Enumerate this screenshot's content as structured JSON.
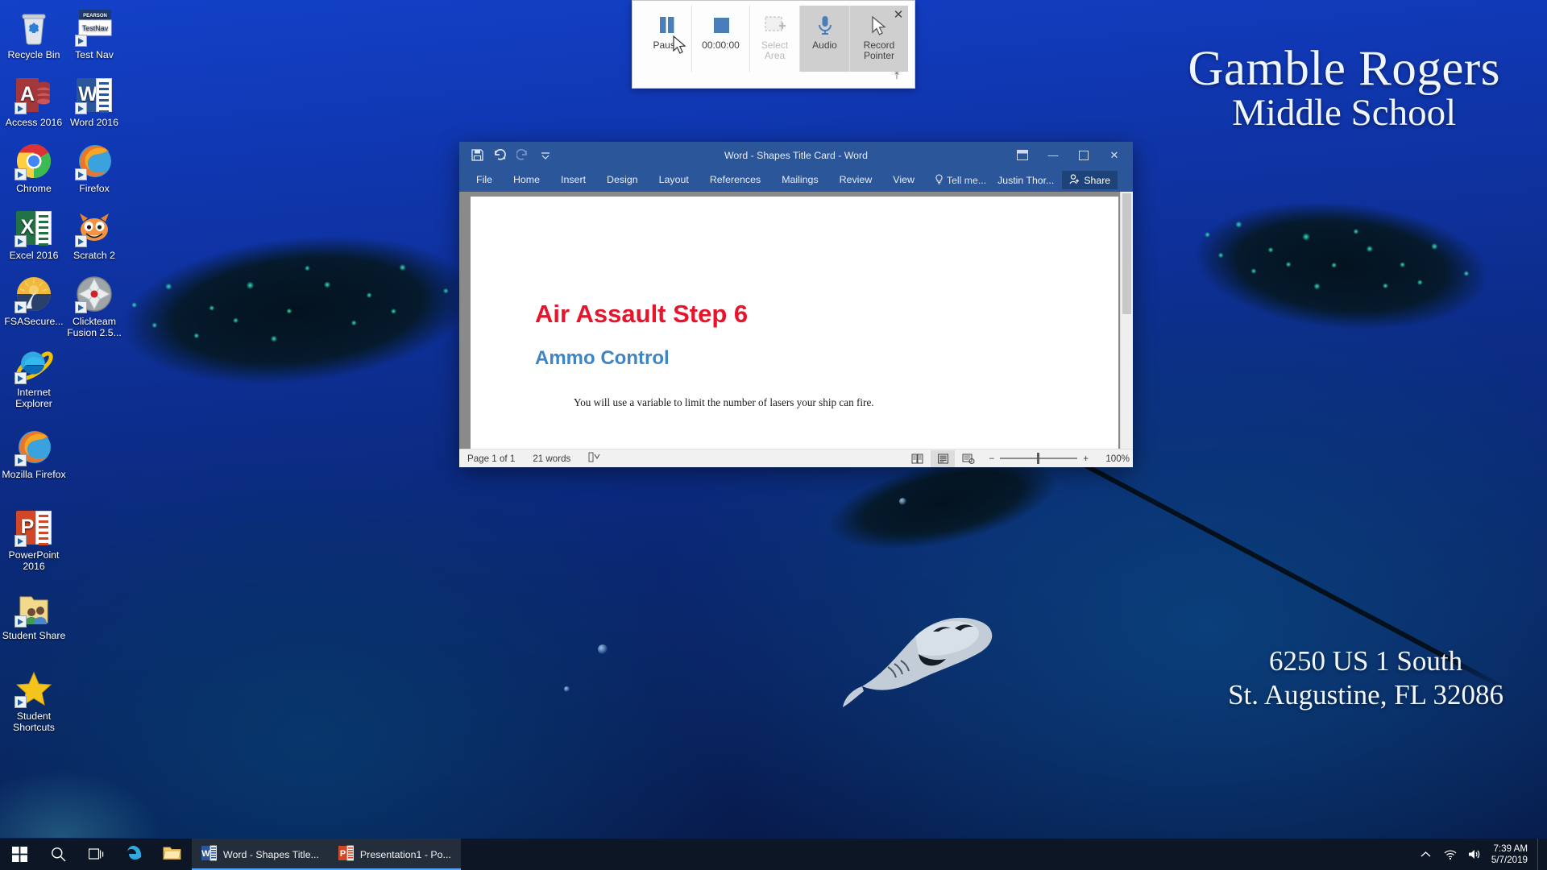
{
  "wallpaper": {
    "school_line1": "Gamble Rogers",
    "school_line2": "Middle School",
    "address_line1": "6250 US 1 South",
    "address_line2": "St. Augustine, FL 32086",
    "background_color": "#0e3099",
    "logo_name": "stingray-mascot"
  },
  "desktop_icons": [
    {
      "label": "Recycle Bin",
      "icon": "recycle-bin-icon",
      "shortcut": false,
      "col": 0,
      "row": 0
    },
    {
      "label": "Test Nav",
      "icon": "pearson-testnav-icon",
      "shortcut": true,
      "col": 1,
      "row": 0
    },
    {
      "label": "Access 2016",
      "icon": "access-2016-icon",
      "shortcut": true,
      "col": 0,
      "row": 1
    },
    {
      "label": "Word 2016",
      "icon": "word-2016-icon",
      "shortcut": true,
      "col": 1,
      "row": 1
    },
    {
      "label": "Chrome",
      "icon": "google-chrome-icon",
      "shortcut": true,
      "col": 0,
      "row": 2
    },
    {
      "label": "Firefox",
      "icon": "firefox-icon",
      "shortcut": true,
      "col": 1,
      "row": 2
    },
    {
      "label": "Excel 2016",
      "icon": "excel-2016-icon",
      "shortcut": true,
      "col": 0,
      "row": 3
    },
    {
      "label": "Scratch 2",
      "icon": "scratch-2-icon",
      "shortcut": true,
      "col": 1,
      "row": 3
    },
    {
      "label": "FSASecure...",
      "icon": "fsa-secure-browser-icon",
      "shortcut": true,
      "col": 0,
      "row": 4
    },
    {
      "label": "Clickteam Fusion 2.5...",
      "icon": "clickteam-fusion-icon",
      "shortcut": true,
      "col": 1,
      "row": 4
    },
    {
      "label": "Internet Explorer",
      "icon": "internet-explorer-icon",
      "shortcut": true,
      "col": 0,
      "row": 5
    },
    {
      "label": "Mozilla Firefox",
      "icon": "mozilla-firefox-icon",
      "shortcut": true,
      "col": 0,
      "row": 6
    },
    {
      "label": "PowerPoint 2016",
      "icon": "powerpoint-2016-icon",
      "shortcut": true,
      "col": 0,
      "row": 7
    },
    {
      "label": "Student Share",
      "icon": "shared-folder-icon",
      "shortcut": true,
      "col": 0,
      "row": 8
    },
    {
      "label": "Student Shortcuts",
      "icon": "star-folder-icon",
      "shortcut": true,
      "col": 0,
      "row": 9
    }
  ],
  "record_toolbar": {
    "pause_label": "Pause",
    "timer_label": "00:00:00",
    "select_area_label": "Select Area",
    "select_area_line1": "Select",
    "select_area_line2": "Area",
    "audio_label": "Audio",
    "record_pointer_line1": "Record",
    "record_pointer_line2": "Pointer",
    "close_label": "✕",
    "pin_label": "⤒",
    "accent_color": "#4a7ebb"
  },
  "word_window": {
    "title": "Word - Shapes Title Card - Word",
    "titlebar_color": "#2b579a",
    "quick_access": [
      {
        "name": "save-icon",
        "label": "Save"
      },
      {
        "name": "undo-icon",
        "label": "Undo"
      },
      {
        "name": "redo-icon",
        "label": "Redo"
      },
      {
        "name": "customize-quick-access-icon",
        "label": "Customize Quick Access Toolbar"
      }
    ],
    "window_buttons": [
      {
        "name": "ribbon-display-options-button",
        "glyph": "⬚"
      },
      {
        "name": "minimize-button",
        "glyph": "—"
      },
      {
        "name": "restore-button",
        "glyph": "❐"
      },
      {
        "name": "close-button",
        "glyph": "✕"
      }
    ],
    "tabs": [
      "File",
      "Home",
      "Insert",
      "Design",
      "Layout",
      "References",
      "Mailings",
      "Review",
      "View"
    ],
    "tell_me": "Tell me...",
    "user": "Justin Thor...",
    "share": "Share",
    "document": {
      "title": "Air Assault Step 6",
      "title_color": "#e8142b",
      "subtitle": "Ammo Control",
      "subtitle_color": "#3d85c6",
      "body": "You will use a variable to limit the number of lasers your ship can fire."
    },
    "status_bar": {
      "page": "Page 1 of 1",
      "words": "21 words",
      "proofing": "proofing-errors-icon",
      "views": [
        {
          "name": "read-mode-view-button",
          "selected": false
        },
        {
          "name": "print-layout-view-button",
          "selected": true
        },
        {
          "name": "web-layout-view-button",
          "selected": false
        }
      ],
      "zoom_out": "−",
      "zoom_in": "+",
      "zoom_level": "100%"
    }
  },
  "taskbar": {
    "start_label": "Start",
    "search_label": "Search",
    "task_view_label": "Task View",
    "pinned": [
      {
        "label": "Microsoft Edge",
        "icon": "edge-icon"
      },
      {
        "label": "File Explorer",
        "icon": "file-explorer-icon"
      }
    ],
    "open_windows": [
      {
        "label": "Word - Shapes Title...",
        "icon": "word-2016-icon"
      },
      {
        "label": "Presentation1 - Po...",
        "icon": "powerpoint-2016-icon"
      }
    ],
    "tray": [
      {
        "name": "show-hidden-icons-button",
        "glyph": "⌃"
      },
      {
        "name": "network-wifi-icon",
        "glyph": "wifi"
      },
      {
        "name": "volume-icon",
        "glyph": "speaker"
      }
    ],
    "clock_time": "7:39 AM",
    "clock_date": "5/7/2019"
  }
}
